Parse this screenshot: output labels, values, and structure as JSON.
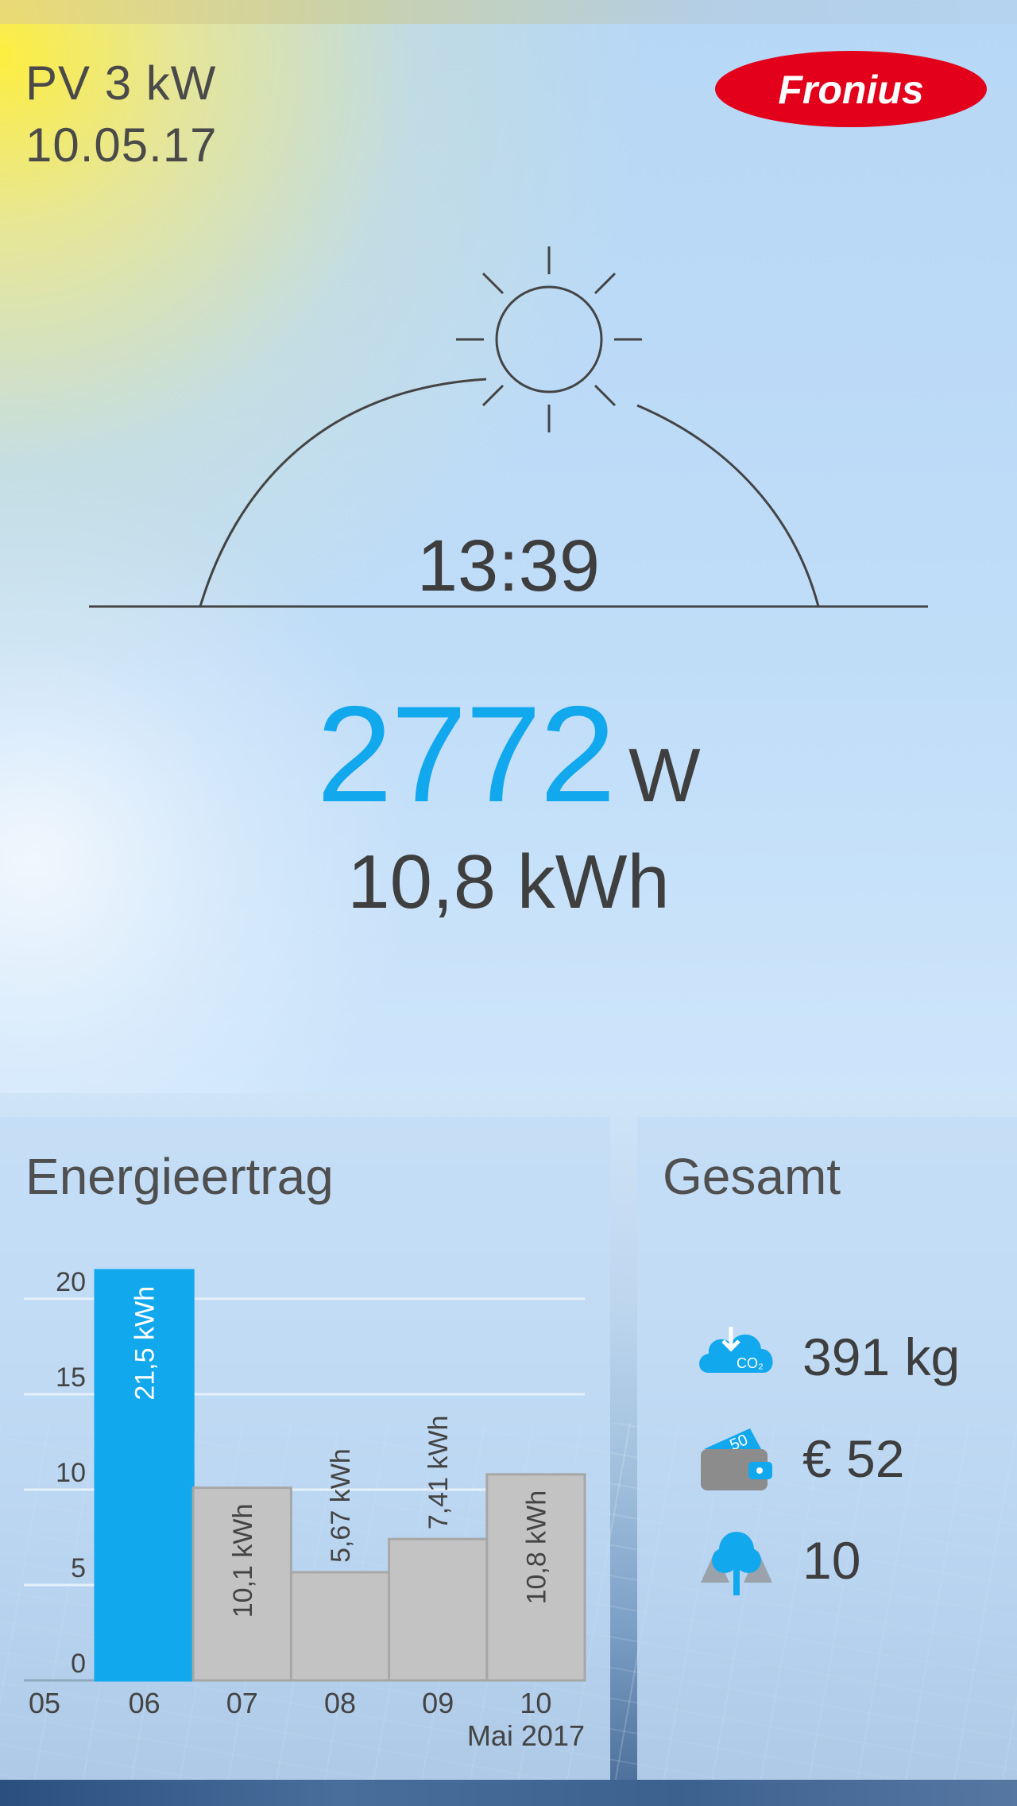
{
  "header": {
    "system": "PV 3 kW",
    "date": "10.05.17",
    "logo_text": "Fronius"
  },
  "sun": {
    "time": "13:39",
    "icon": "sun-icon"
  },
  "current": {
    "power_value": "2772",
    "power_unit": "W",
    "energy_today": "10,8 kWh"
  },
  "energy_card": {
    "title": "Energieertrag",
    "month_label": "Mai 2017"
  },
  "total_card": {
    "title": "Gesamt",
    "stats": [
      {
        "icon": "co2-cloud-icon",
        "value": "391 kg"
      },
      {
        "icon": "wallet-money-icon",
        "value": "€ 52"
      },
      {
        "icon": "trees-icon",
        "value": "10"
      }
    ]
  },
  "colors": {
    "accent": "#12a8ee",
    "bar_gray": "#c3c3c3",
    "text": "#3e3e3e",
    "brand_red": "#e2001a"
  },
  "chart_data": {
    "type": "bar",
    "x_ticks": [
      "05",
      "06",
      "07",
      "08",
      "09",
      "10"
    ],
    "categories": [
      "06",
      "07",
      "08",
      "09",
      "10"
    ],
    "values": [
      21.5,
      10.1,
      5.67,
      7.41,
      10.8
    ],
    "data_labels": [
      "21,5 kWh",
      "10,1 kWh",
      "5,67 kWh",
      "7,41 kWh",
      "10,8 kWh"
    ],
    "highlighted_index": 0,
    "y_ticks": [
      0,
      5,
      10,
      15,
      20
    ],
    "ylim": [
      0,
      20
    ],
    "grid": true,
    "xlabel": "Mai 2017",
    "ylabel": "",
    "title": "Energieertrag"
  }
}
